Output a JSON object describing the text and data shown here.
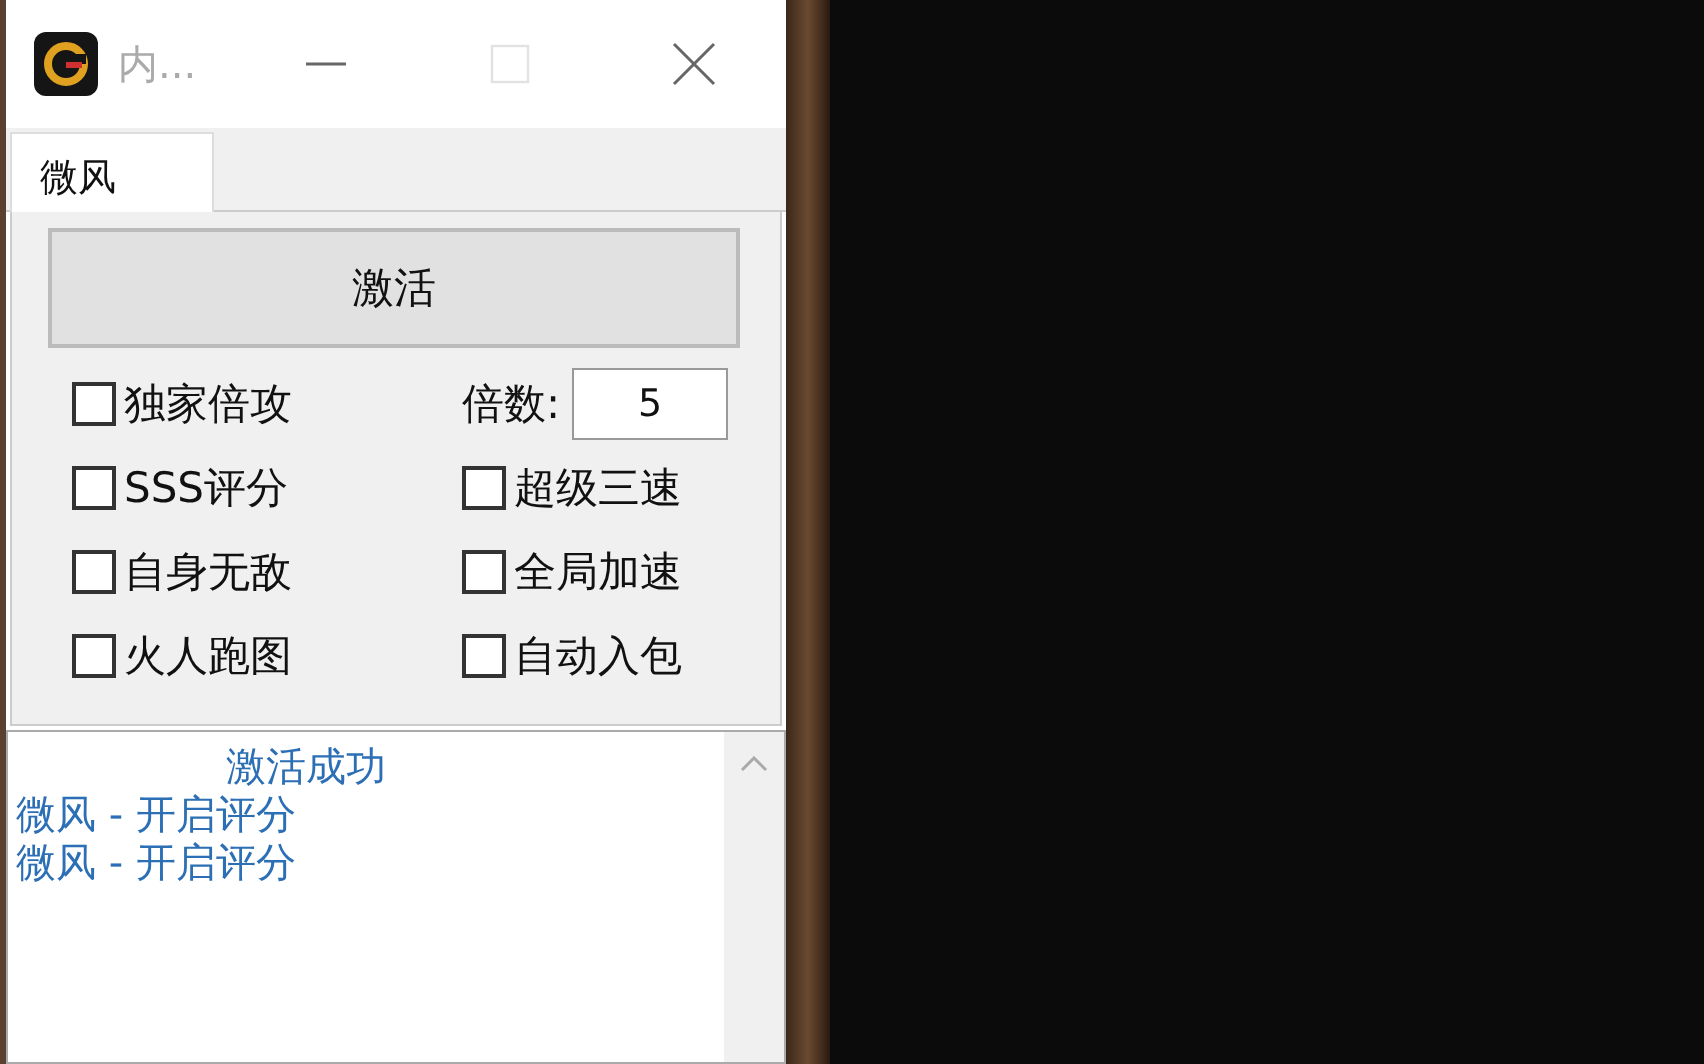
{
  "window": {
    "title": "内...",
    "controls": [
      {
        "kind": "minimize",
        "disabled": false
      },
      {
        "kind": "maximize",
        "disabled": true
      },
      {
        "kind": "close",
        "disabled": false
      }
    ]
  },
  "tabs": [
    {
      "label": "微风",
      "selected": true
    }
  ],
  "activate_button": "激活",
  "options": [
    {
      "kind": "checkbox",
      "label": "独家倍攻",
      "checked": false
    },
    {
      "kind": "number",
      "label": "倍数:",
      "value": "5"
    },
    {
      "kind": "checkbox",
      "label": "SSS评分",
      "checked": false
    },
    {
      "kind": "checkbox",
      "label": "超级三速",
      "checked": false
    },
    {
      "kind": "checkbox",
      "label": "自身无敌",
      "checked": false
    },
    {
      "kind": "checkbox",
      "label": "全局加速",
      "checked": false
    },
    {
      "kind": "checkbox",
      "label": "火人跑图",
      "checked": false
    },
    {
      "kind": "checkbox",
      "label": "自动入包",
      "checked": false
    }
  ],
  "log": [
    {
      "text": "激活成功",
      "kind": "status"
    },
    {
      "text": "微风 - 开启评分",
      "kind": "entry"
    },
    {
      "text": "微风 - 开启评分",
      "kind": "entry"
    }
  ]
}
